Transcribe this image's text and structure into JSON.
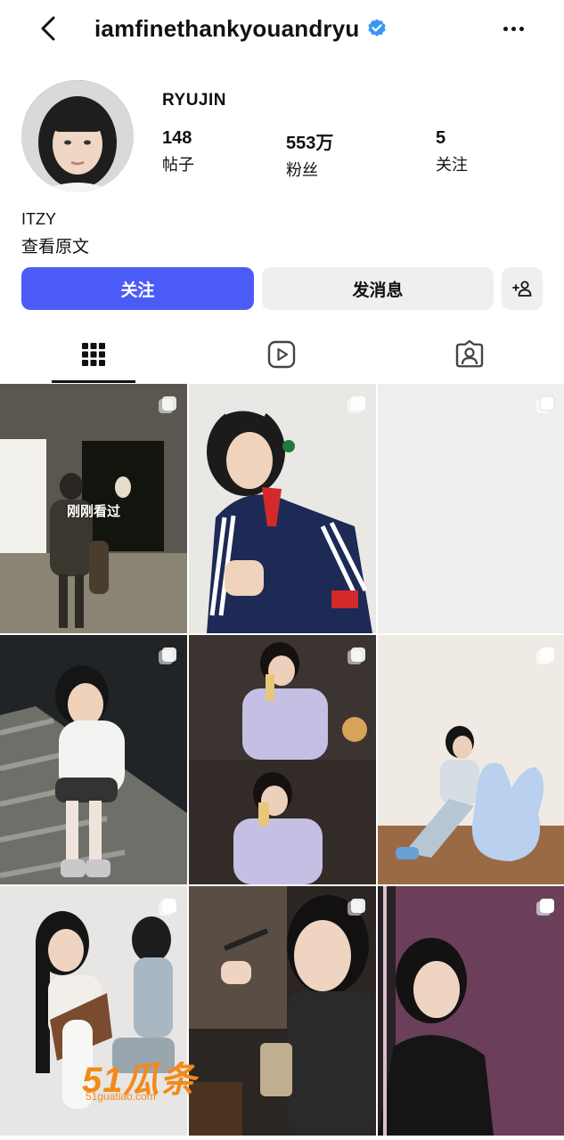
{
  "header": {
    "back_icon": "chevron-left-icon",
    "username": "iamfinethankyouandryu",
    "verified_icon": "verified-badge-icon",
    "more_icon": "more-horizontal-icon"
  },
  "profile": {
    "display_name": "RYUJIN",
    "stats": [
      {
        "value": "148",
        "label": "帖子"
      },
      {
        "value": "553万",
        "label": "粉丝"
      },
      {
        "value": "5",
        "label": "关注"
      }
    ],
    "bio": "ITZY",
    "translate_label": "查看原文"
  },
  "actions": {
    "follow_label": "关注",
    "message_label": "发消息",
    "add_person_icon": "add-person-icon"
  },
  "tabs": [
    {
      "icon": "grid-icon",
      "active": true
    },
    {
      "icon": "reels-icon",
      "active": false
    },
    {
      "icon": "tagged-icon",
      "active": false
    }
  ],
  "grid": {
    "seen_label": "刚刚看过",
    "multi_icon": "carousel-icon"
  },
  "watermark": {
    "text": "51瓜条",
    "sub": "51guatiao.com"
  },
  "colors": {
    "accent": "#4b5cf6",
    "verified": "#3897f0"
  }
}
